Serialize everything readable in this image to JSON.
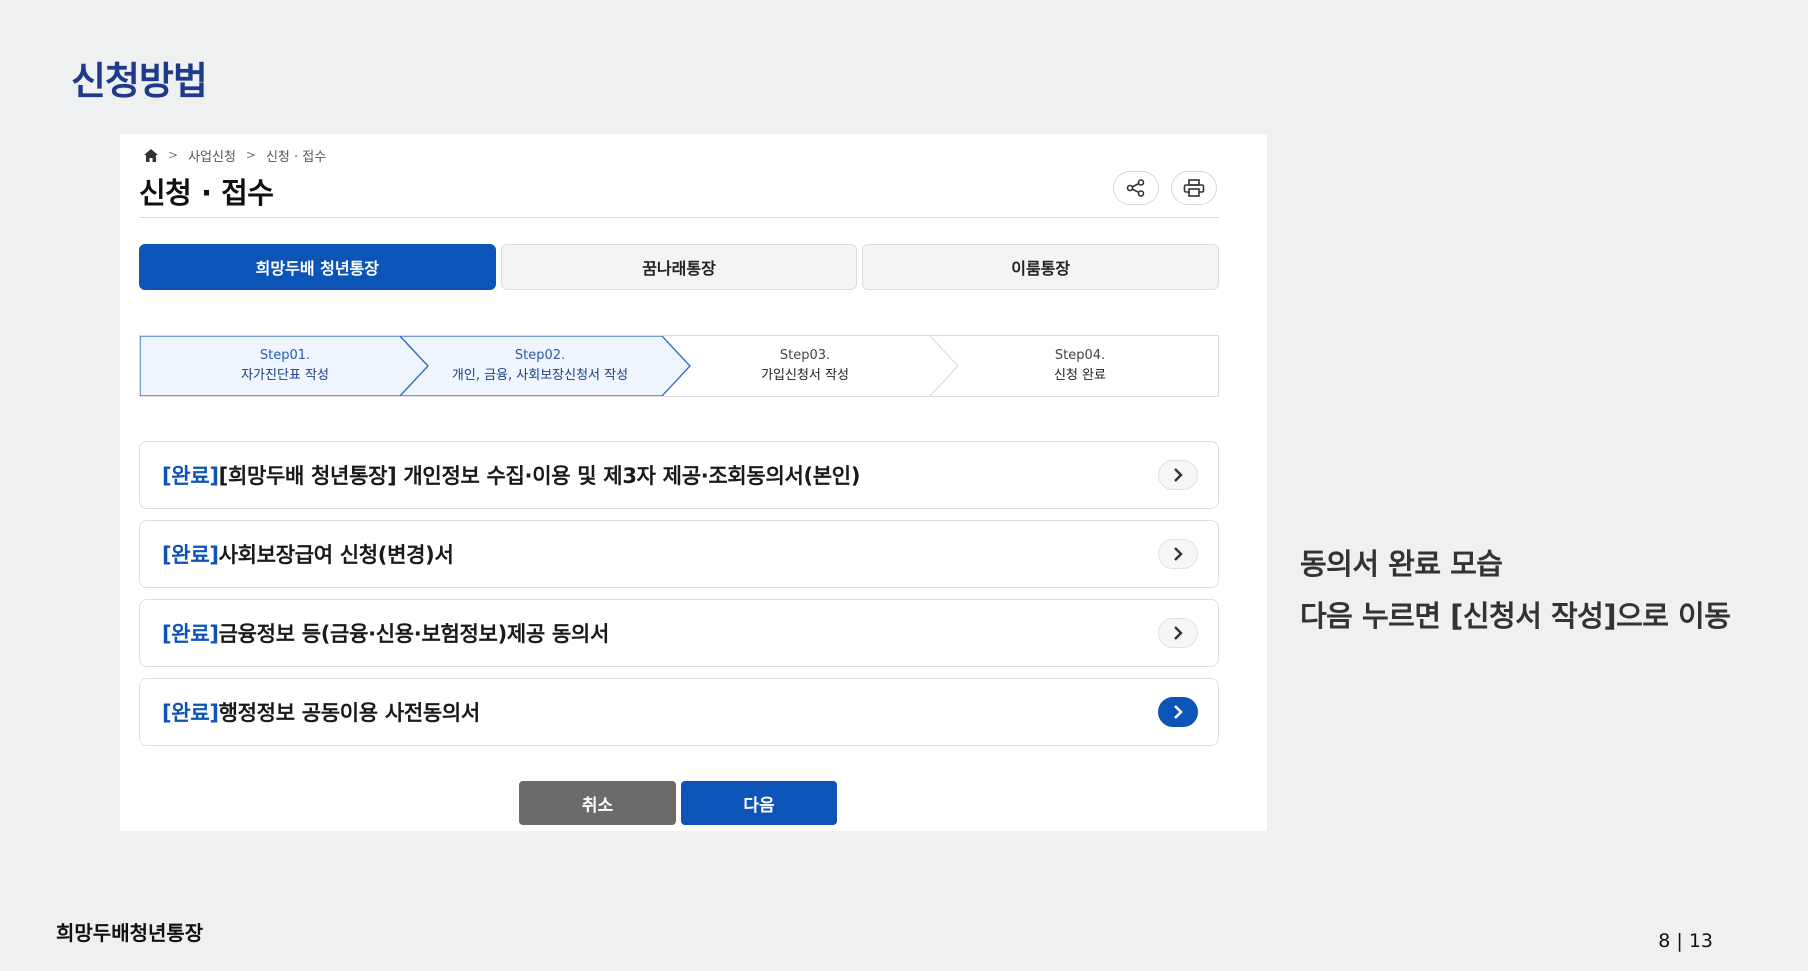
{
  "slide": {
    "title": "신청방법",
    "note_line1": "동의서 완료 모습",
    "note_line2": "다음 누르면 [신청서 작성]으로 이동",
    "footer_left": "희망두배청년통장",
    "page_indicator": "8 | 13"
  },
  "breadcrumb": {
    "icon": "home-icon",
    "items": [
      "사업신청",
      "신청 · 접수"
    ]
  },
  "page": {
    "title": "신청 · 접수",
    "share_icon": "share-icon",
    "print_icon": "print-icon"
  },
  "tabs": [
    {
      "label": "희망두배 청년통장",
      "active": true
    },
    {
      "label": "꿈나래통장",
      "active": false
    },
    {
      "label": "이룸통장",
      "active": false
    }
  ],
  "steps": [
    {
      "num": "Step01.",
      "name": "자가진단표 작성",
      "state": "done"
    },
    {
      "num": "Step02.",
      "name": "개인, 금융, 사회보장신청서 작성",
      "state": "current"
    },
    {
      "num": "Step03.",
      "name": "가입신청서 작성",
      "state": "todo"
    },
    {
      "num": "Step04.",
      "name": "신청 완료",
      "state": "todo"
    }
  ],
  "documents": [
    {
      "tag": "[완료]",
      "title": "[희망두배 청년통장] 개인정보 수집·이용 및 제3자 제공·조회동의서(본인)",
      "highlighted": false
    },
    {
      "tag": "[완료]",
      "title": "사회보장급여 신청(변경)서",
      "highlighted": false
    },
    {
      "tag": "[완료]",
      "title": "금융정보 등(금융·신용·보험정보)제공 동의서",
      "highlighted": false
    },
    {
      "tag": "[완료]",
      "title": "행정정보 공동이용 사전동의서",
      "highlighted": true
    }
  ],
  "buttons": {
    "cancel": "취소",
    "next": "다음"
  },
  "colors": {
    "accent": "#0d54b8",
    "slide_title": "#1f3a8a",
    "step_active_bg": "#eef5fc",
    "step_active_border": "#2d6bbf",
    "cancel_bg": "#6b6b6b"
  }
}
